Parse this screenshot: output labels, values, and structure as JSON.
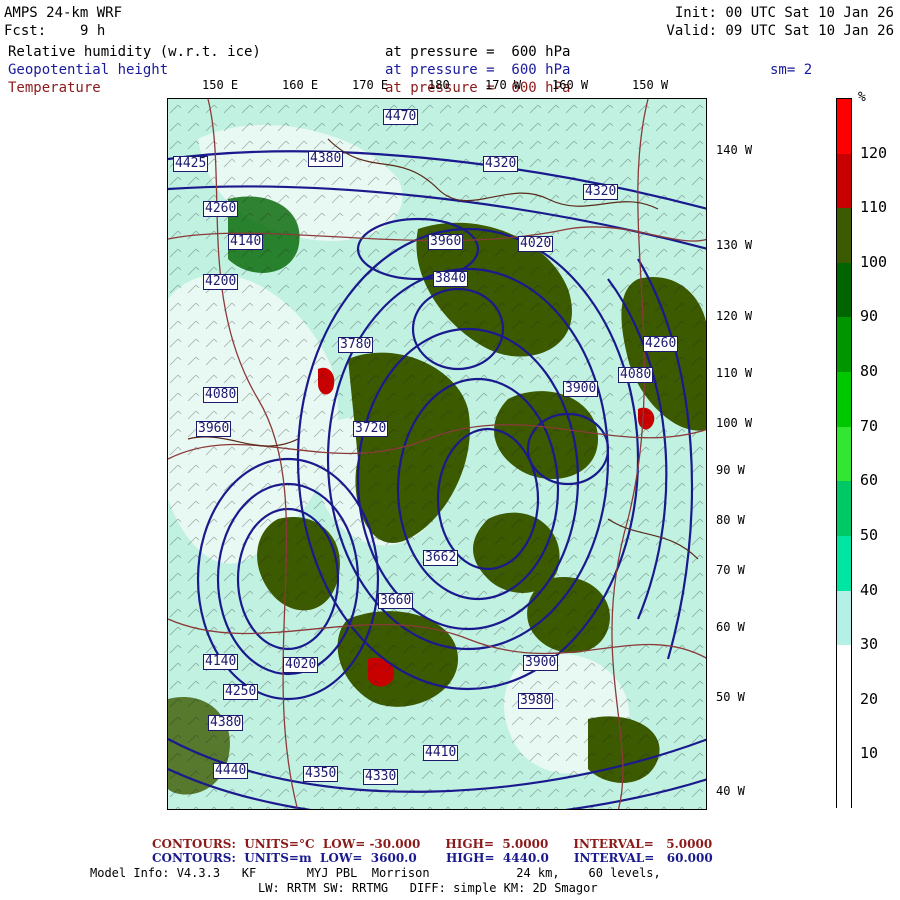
{
  "header": {
    "title": "AMPS 24-km WRF",
    "fcst_label": "Fcst:",
    "fcst_value": "9 h",
    "init": "Init: 00 UTC Sat 10 Jan 26",
    "valid": "Valid: 09 UTC Sat 10 Jan 26",
    "field1": "Relative humidity (w.r.t. ice)",
    "field2": "Geopotential height",
    "field3": "Temperature",
    "level1": "at pressure =  600 hPa",
    "level2": "at pressure =  600 hPa",
    "level3": "at pressure =  600 hPa",
    "smooth": "sm= 2"
  },
  "lon_labels_top": [
    "150 E",
    "160 E",
    "170 E",
    "180",
    "170 W",
    "160 W",
    "150 W"
  ],
  "lat_labels_right": [
    "140 W",
    "130 W",
    "120 W",
    "110 W",
    "100 W",
    "90 W",
    "80 W",
    "70 W",
    "60 W",
    "50 W",
    "40 W"
  ],
  "colorbar": {
    "unit": "%",
    "ticks": [
      "120",
      "110",
      "100",
      "90",
      "80",
      "70",
      "60",
      "50",
      "40",
      "30",
      "20",
      "10"
    ],
    "colors": [
      "#ff0000",
      "#c80000",
      "#3c5a00",
      "#006400",
      "#009600",
      "#00c800",
      "#32e632",
      "#00c864",
      "#00e6a0",
      "#b4f0e6",
      "#ffffff",
      "#ffffff",
      "#ffffff"
    ]
  },
  "height_labels": [
    {
      "text": "4470"
    },
    {
      "text": "4425"
    },
    {
      "text": "4380"
    },
    {
      "text": "4320"
    },
    {
      "text": "4260"
    },
    {
      "text": "4140"
    },
    {
      "text": "4200"
    },
    {
      "text": "4020"
    },
    {
      "text": "3960"
    },
    {
      "text": "3840"
    },
    {
      "text": "4080"
    },
    {
      "text": "3780"
    },
    {
      "text": "3900"
    },
    {
      "text": "3662"
    },
    {
      "text": "3720"
    },
    {
      "text": "3660"
    },
    {
      "text": "4440"
    },
    {
      "text": "4350"
    },
    {
      "text": "4330"
    },
    {
      "text": "4410"
    },
    {
      "text": "4380"
    },
    {
      "text": "3980"
    },
    {
      "text": "4250"
    },
    {
      "text": "4260"
    },
    {
      "text": "4320"
    },
    {
      "text": "4140"
    },
    {
      "text": "4020"
    },
    {
      "text": "4080"
    },
    {
      "text": "3900"
    },
    {
      "text": "3960"
    }
  ],
  "footer": {
    "red_line": "CONTOURS:  UNITS=°C  LOW= -30.000      HIGH=  5.0000      INTERVAL=   5.0000",
    "blue_line": "CONTOURS:  UNITS=m  LOW=  3600.0       HIGH=  4440.0      INTERVAL=   60.000",
    "model_line": "Model Info: V4.3.3   KF       MYJ PBL  Morrison            24 km,    60 levels,",
    "model_line2": "LW: RRTM SW: RRTMG   DIFF: simple KM: 2D Smagor"
  }
}
